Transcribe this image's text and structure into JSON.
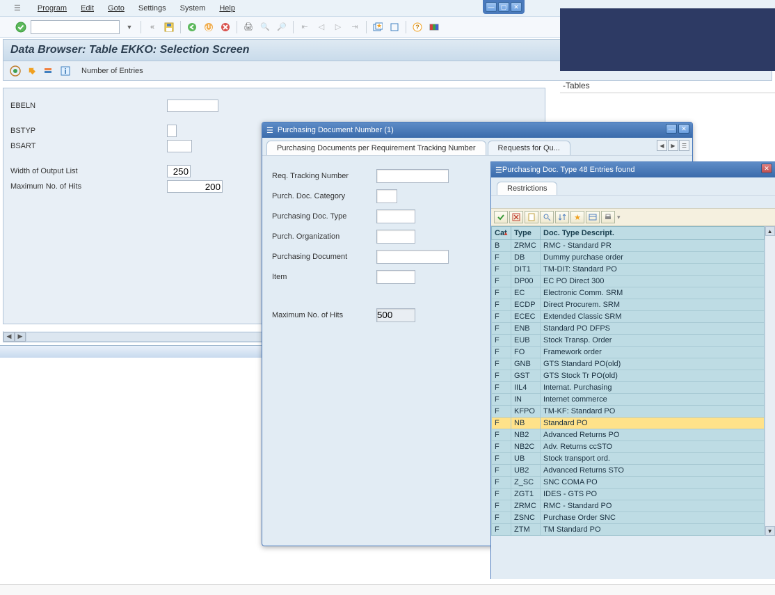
{
  "menu": {
    "program": "Program",
    "edit": "Edit",
    "goto": "Goto",
    "settings": "Settings",
    "system": "System",
    "help": "Help"
  },
  "title": "Data Browser: Table EKKO: Selection Screen",
  "app_toolbar": {
    "entries": "Number of Entries"
  },
  "sel": {
    "ebeln": "EBELN",
    "bstyp": "BSTYP",
    "bsart": "BSART",
    "width": "Width of Output List",
    "width_val": "250",
    "max": "Maximum No. of Hits",
    "max_val": "200"
  },
  "right_tab": "-Tables",
  "popup1": {
    "title": "Purchasing Document Number (1)",
    "tab1": "Purchasing Documents per Requirement Tracking Number",
    "tab2": "Requests for Qu...",
    "f1": "Req. Tracking Number",
    "f2": "Purch. Doc. Category",
    "f3": "Purchasing Doc. Type",
    "f4": "Purch. Organization",
    "f5": "Purchasing Document",
    "f6": "Item",
    "f7": "Maximum No. of Hits",
    "max_val": "500"
  },
  "popup2": {
    "title": "Purchasing Doc. Type   48 Entries found",
    "restrictions": "Restrictions",
    "h0": "Cat",
    "h1": "Type",
    "h2": "Doc. Type Descript.",
    "rows": [
      {
        "c": "B",
        "t": "ZRMC",
        "d": "RMC - Standard PR"
      },
      {
        "c": "F",
        "t": "DB",
        "d": "Dummy purchase order"
      },
      {
        "c": "F",
        "t": "DIT1",
        "d": "TM-DIT: Standard PO"
      },
      {
        "c": "F",
        "t": "DP00",
        "d": "EC PO Direct 300"
      },
      {
        "c": "F",
        "t": "EC",
        "d": "Electronic Comm. SRM"
      },
      {
        "c": "F",
        "t": "ECDP",
        "d": "Direct Procurem. SRM"
      },
      {
        "c": "F",
        "t": "ECEC",
        "d": "Extended Classic SRM"
      },
      {
        "c": "F",
        "t": "ENB",
        "d": "Standard PO DFPS"
      },
      {
        "c": "F",
        "t": "EUB",
        "d": "Stock Transp. Order"
      },
      {
        "c": "F",
        "t": "FO",
        "d": "Framework order"
      },
      {
        "c": "F",
        "t": "GNB",
        "d": "GTS Standard PO(old)"
      },
      {
        "c": "F",
        "t": "GST",
        "d": "GTS Stock Tr PO(old)"
      },
      {
        "c": "F",
        "t": "IIL4",
        "d": "Internat. Purchasing"
      },
      {
        "c": "F",
        "t": "IN",
        "d": "Internet commerce"
      },
      {
        "c": "F",
        "t": "KFPO",
        "d": "TM-KF: Standard PO"
      },
      {
        "c": "F",
        "t": "NB",
        "d": "Standard PO",
        "sel": true
      },
      {
        "c": "F",
        "t": "NB2",
        "d": "Advanced Returns PO"
      },
      {
        "c": "F",
        "t": "NB2C",
        "d": "Adv. Returns ccSTO"
      },
      {
        "c": "F",
        "t": "UB",
        "d": "Stock transport ord."
      },
      {
        "c": "F",
        "t": "UB2",
        "d": "Advanced Returns STO"
      },
      {
        "c": "F",
        "t": "Z_SC",
        "d": "SNC COMA PO"
      },
      {
        "c": "F",
        "t": "ZGT1",
        "d": "IDES - GTS PO"
      },
      {
        "c": "F",
        "t": "ZRMC",
        "d": "RMC - Standard PO"
      },
      {
        "c": "F",
        "t": "ZSNC",
        "d": "Purchase Order SNC"
      },
      {
        "c": "F",
        "t": "ZTM",
        "d": "TM Standard PO"
      }
    ]
  }
}
